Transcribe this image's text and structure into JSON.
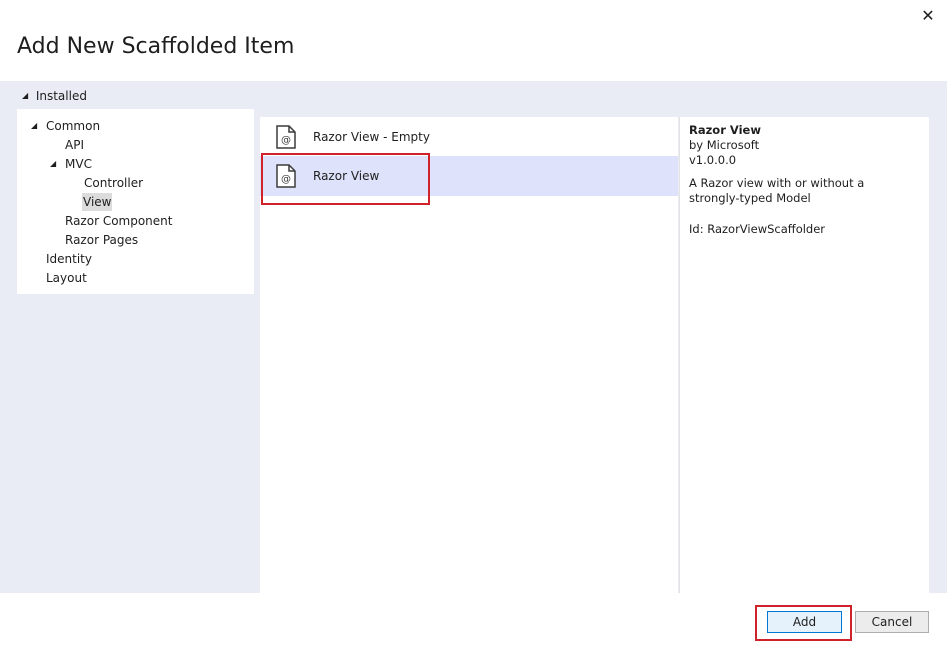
{
  "dialog": {
    "title": "Add New Scaffolded Item",
    "close_glyph": "✕"
  },
  "installed_header": "Installed",
  "tree": {
    "common": "Common",
    "api": "API",
    "mvc": "MVC",
    "controller": "Controller",
    "view": "View",
    "razor_component": "Razor Component",
    "razor_pages": "Razor Pages",
    "identity": "Identity",
    "layout": "Layout",
    "selected": "View"
  },
  "templates": [
    {
      "label": "Razor View - Empty",
      "icon": "razor-file-icon"
    },
    {
      "label": "Razor View",
      "icon": "razor-file-icon",
      "selected": true
    }
  ],
  "details": {
    "name": "Razor View",
    "author": "by Microsoft",
    "version": "v1.0.0.0",
    "description": "A Razor view with or without a strongly-typed Model",
    "id": "Id: RazorViewScaffolder"
  },
  "buttons": {
    "add": "Add",
    "cancel": "Cancel"
  },
  "colors": {
    "dialog_background": "#ffffff",
    "body_background": "#e9ecf5",
    "selected_row": "#dee2fa",
    "highlight_outline": "#d0222b"
  }
}
